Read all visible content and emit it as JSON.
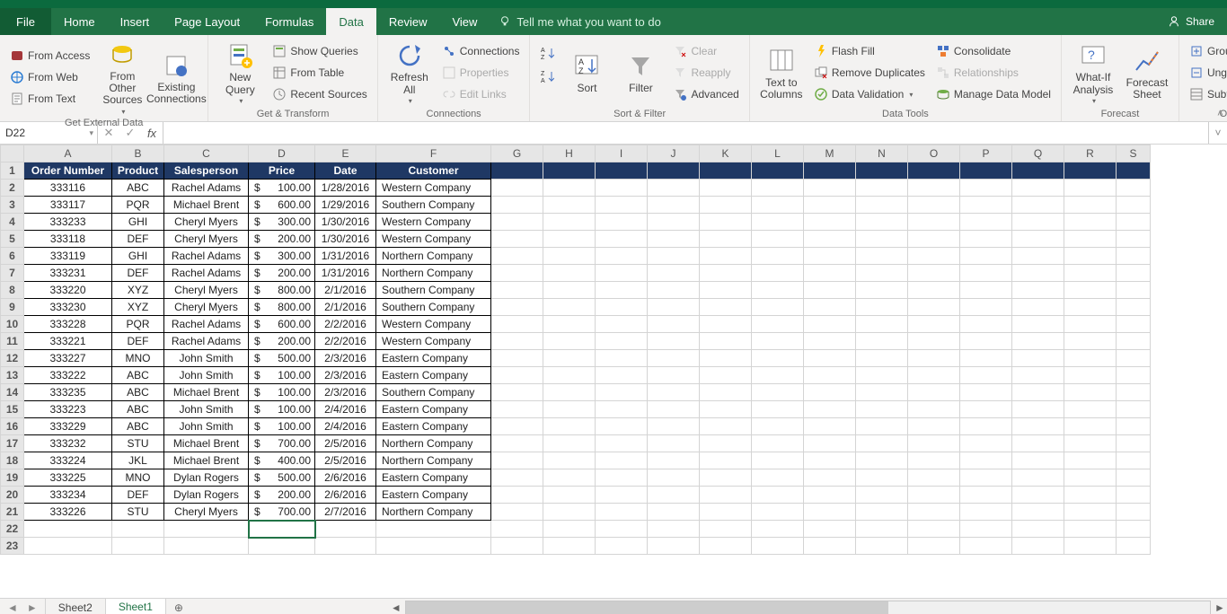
{
  "colors": {
    "accent": "#217346",
    "header_fill": "#1f3864"
  },
  "tabs": {
    "file": "File",
    "list": [
      "Home",
      "Insert",
      "Page Layout",
      "Formulas",
      "Data",
      "Review",
      "View"
    ],
    "active": "Data",
    "tellme": "Tell me what you want to do",
    "share": "Share"
  },
  "ribbon": {
    "get_external": {
      "label": "Get External Data",
      "from_access": "From Access",
      "from_web": "From Web",
      "from_text": "From Text",
      "from_other": "From Other Sources",
      "existing": "Existing Connections"
    },
    "get_transform": {
      "label": "Get & Transform",
      "new_query": "New Query",
      "show_queries": "Show Queries",
      "from_table": "From Table",
      "recent_sources": "Recent Sources"
    },
    "connections": {
      "label": "Connections",
      "refresh": "Refresh All",
      "connections": "Connections",
      "properties": "Properties",
      "edit_links": "Edit Links"
    },
    "sort_filter": {
      "label": "Sort & Filter",
      "sort": "Sort",
      "filter": "Filter",
      "clear": "Clear",
      "reapply": "Reapply",
      "advanced": "Advanced"
    },
    "data_tools": {
      "label": "Data Tools",
      "text_to_columns": "Text to Columns",
      "flash_fill": "Flash Fill",
      "remove_duplicates": "Remove Duplicates",
      "data_validation": "Data Validation",
      "consolidate": "Consolidate",
      "relationships": "Relationships",
      "manage_dm": "Manage Data Model"
    },
    "forecast": {
      "label": "Forecast",
      "whatif": "What-If Analysis",
      "forecast_sheet": "Forecast Sheet"
    },
    "outline": {
      "label": "Outline",
      "group": "Group",
      "ungroup": "Ungroup",
      "subtotal": "Subtotal"
    }
  },
  "namebox": "D22",
  "formula": "",
  "columns": [
    "A",
    "B",
    "C",
    "D",
    "E",
    "F",
    "G",
    "H",
    "I",
    "J",
    "K",
    "L",
    "M",
    "N",
    "O",
    "P",
    "Q",
    "R",
    "S"
  ],
  "headers": [
    "Order Number",
    "Product",
    "Salesperson",
    "Price",
    "Date",
    "Customer"
  ],
  "rows": [
    {
      "n": "333116",
      "p": "ABC",
      "s": "Rachel Adams",
      "pr": "100.00",
      "d": "1/28/2016",
      "c": "Western Company"
    },
    {
      "n": "333117",
      "p": "PQR",
      "s": "Michael Brent",
      "pr": "600.00",
      "d": "1/29/2016",
      "c": "Southern Company"
    },
    {
      "n": "333233",
      "p": "GHI",
      "s": "Cheryl Myers",
      "pr": "300.00",
      "d": "1/30/2016",
      "c": "Western Company"
    },
    {
      "n": "333118",
      "p": "DEF",
      "s": "Cheryl Myers",
      "pr": "200.00",
      "d": "1/30/2016",
      "c": "Western Company"
    },
    {
      "n": "333119",
      "p": "GHI",
      "s": "Rachel Adams",
      "pr": "300.00",
      "d": "1/31/2016",
      "c": "Northern Company"
    },
    {
      "n": "333231",
      "p": "DEF",
      "s": "Rachel Adams",
      "pr": "200.00",
      "d": "1/31/2016",
      "c": "Northern Company"
    },
    {
      "n": "333220",
      "p": "XYZ",
      "s": "Cheryl Myers",
      "pr": "800.00",
      "d": "2/1/2016",
      "c": "Southern Company"
    },
    {
      "n": "333230",
      "p": "XYZ",
      "s": "Cheryl Myers",
      "pr": "800.00",
      "d": "2/1/2016",
      "c": "Southern Company"
    },
    {
      "n": "333228",
      "p": "PQR",
      "s": "Rachel Adams",
      "pr": "600.00",
      "d": "2/2/2016",
      "c": "Western Company"
    },
    {
      "n": "333221",
      "p": "DEF",
      "s": "Rachel Adams",
      "pr": "200.00",
      "d": "2/2/2016",
      "c": "Western Company"
    },
    {
      "n": "333227",
      "p": "MNO",
      "s": "John Smith",
      "pr": "500.00",
      "d": "2/3/2016",
      "c": "Eastern Company"
    },
    {
      "n": "333222",
      "p": "ABC",
      "s": "John Smith",
      "pr": "100.00",
      "d": "2/3/2016",
      "c": "Eastern Company"
    },
    {
      "n": "333235",
      "p": "ABC",
      "s": "Michael Brent",
      "pr": "100.00",
      "d": "2/3/2016",
      "c": "Southern Company"
    },
    {
      "n": "333223",
      "p": "ABC",
      "s": "John Smith",
      "pr": "100.00",
      "d": "2/4/2016",
      "c": "Eastern Company"
    },
    {
      "n": "333229",
      "p": "ABC",
      "s": "John Smith",
      "pr": "100.00",
      "d": "2/4/2016",
      "c": "Eastern Company"
    },
    {
      "n": "333232",
      "p": "STU",
      "s": "Michael Brent",
      "pr": "700.00",
      "d": "2/5/2016",
      "c": "Northern Company"
    },
    {
      "n": "333224",
      "p": "JKL",
      "s": "Michael Brent",
      "pr": "400.00",
      "d": "2/5/2016",
      "c": "Northern Company"
    },
    {
      "n": "333225",
      "p": "MNO",
      "s": "Dylan Rogers",
      "pr": "500.00",
      "d": "2/6/2016",
      "c": "Eastern Company"
    },
    {
      "n": "333234",
      "p": "DEF",
      "s": "Dylan Rogers",
      "pr": "200.00",
      "d": "2/6/2016",
      "c": "Eastern Company"
    },
    {
      "n": "333226",
      "p": "STU",
      "s": "Cheryl Myers",
      "pr": "700.00",
      "d": "2/7/2016",
      "c": "Northern Company"
    }
  ],
  "sheets": {
    "list": [
      "Sheet2",
      "Sheet1"
    ],
    "active": "Sheet1"
  },
  "selected_cell": "D22",
  "total_visible_rows": 23
}
